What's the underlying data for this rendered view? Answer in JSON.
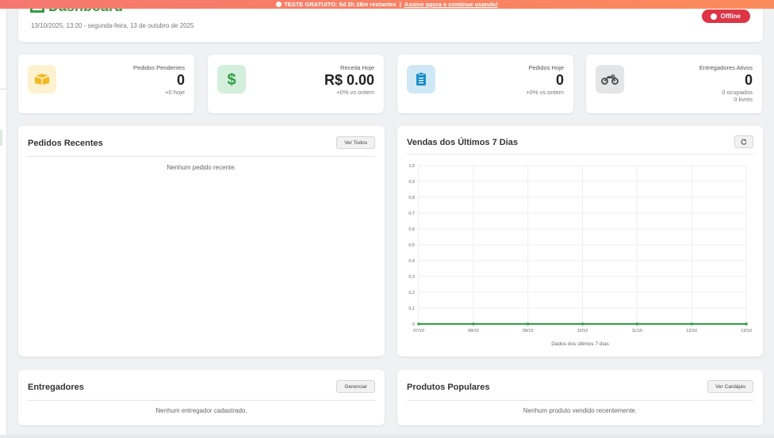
{
  "trial_banner": {
    "text": "TESTE GRATUITO: 5d 2h 28m restantes",
    "separator": "|",
    "link": "Assine agora e continue usando!"
  },
  "header": {
    "title": "Dashboard",
    "date": "13/10/2025, 13:20 - segunda-feira, 13 de outubro de 2025",
    "status": "Offline"
  },
  "stats": [
    {
      "icon": "box-icon",
      "label": "Pedidos Pendentes",
      "value": "0",
      "sub": "+0 hoje",
      "sub2": "",
      "color": "#f5b921",
      "bg": "#fdf2cf"
    },
    {
      "icon": "dollar-icon",
      "label": "Receita Hoje",
      "value": "R$ 0.00",
      "sub": "+0% vs ontem",
      "sub2": "",
      "color": "#2f9e44",
      "bg": "#d4efdb"
    },
    {
      "icon": "clipboard-icon",
      "label": "Pedidos Hoje",
      "value": "0",
      "sub": "+0% vs ontem",
      "sub2": "",
      "color": "#1a8fc7",
      "bg": "#cfe8f6"
    },
    {
      "icon": "motorcycle-icon",
      "label": "Entregadores Ativos",
      "value": "0",
      "sub": "0 ocupados",
      "sub2": "0 livres",
      "color": "#555555",
      "bg": "#e4e5e7"
    }
  ],
  "recent_orders": {
    "title": "Pedidos Recentes",
    "button": "Ver Todos",
    "empty": "Nenhum pedido recente."
  },
  "sales_chart": {
    "title": "Vendas dos Últimos 7 Dias",
    "refresh_icon": "refresh-icon",
    "caption": "Dados dos últimos 7 dias"
  },
  "couriers": {
    "title": "Entregadores",
    "button": "Gerenciar",
    "empty": "Nenhum entregador cadastrado."
  },
  "popular_products": {
    "title": "Produtos Populares",
    "button": "Ver Cardápio",
    "empty": "Nenhum produto vendido recentemente."
  },
  "chart_data": {
    "type": "line",
    "categories": [
      "07/10",
      "08/10",
      "09/10",
      "10/10",
      "11/10",
      "12/10",
      "13/10"
    ],
    "values": [
      0,
      0,
      0,
      0,
      0,
      0,
      0
    ],
    "y_ticks": [
      "0",
      "0,1",
      "0,2",
      "0,3",
      "0,4",
      "0,5",
      "0,6",
      "0,7",
      "0,8",
      "0,9",
      "1,0"
    ],
    "ylim": [
      0,
      1
    ],
    "grid": true,
    "line_color": "#2f9e44",
    "xlabel": "Dados dos últimos 7 dias"
  }
}
